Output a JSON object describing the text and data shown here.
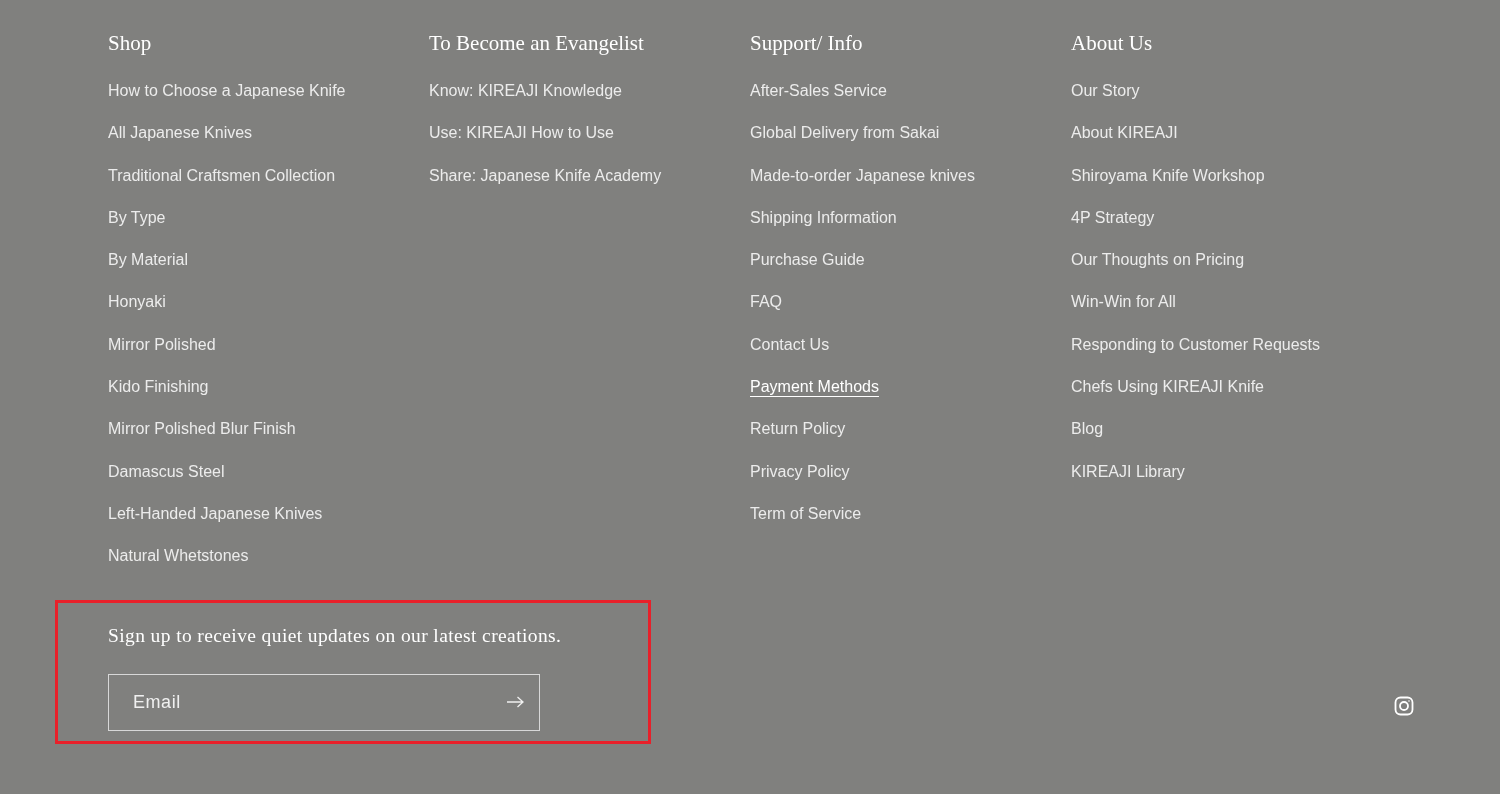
{
  "columns": [
    {
      "heading": "Shop",
      "links": [
        {
          "label": "How to Choose a Japanese Knife",
          "underlined": false
        },
        {
          "label": "All Japanese Knives",
          "underlined": false
        },
        {
          "label": "Traditional Craftsmen Collection",
          "underlined": false
        },
        {
          "label": "By Type",
          "underlined": false
        },
        {
          "label": "By Material",
          "underlined": false
        },
        {
          "label": "Honyaki",
          "underlined": false
        },
        {
          "label": "Mirror Polished",
          "underlined": false
        },
        {
          "label": "Kido Finishing",
          "underlined": false
        },
        {
          "label": "Mirror Polished Blur Finish",
          "underlined": false
        },
        {
          "label": "Damascus Steel",
          "underlined": false
        },
        {
          "label": "Left-Handed Japanese Knives",
          "underlined": false
        },
        {
          "label": "Natural Whetstones",
          "underlined": false
        }
      ]
    },
    {
      "heading": "To Become an Evangelist",
      "links": [
        {
          "label": "Know: KIREAJI Knowledge",
          "underlined": false
        },
        {
          "label": "Use: KIREAJI How to Use",
          "underlined": false
        },
        {
          "label": "Share: Japanese Knife Academy",
          "underlined": false
        }
      ]
    },
    {
      "heading": "Support/ Info",
      "links": [
        {
          "label": "After-Sales Service",
          "underlined": false
        },
        {
          "label": "Global Delivery from Sakai",
          "underlined": false
        },
        {
          "label": "Made-to-order Japanese knives",
          "underlined": false
        },
        {
          "label": "Shipping Information",
          "underlined": false
        },
        {
          "label": "Purchase Guide",
          "underlined": false
        },
        {
          "label": "FAQ",
          "underlined": false
        },
        {
          "label": "Contact Us",
          "underlined": false
        },
        {
          "label": "Payment Methods",
          "underlined": true
        },
        {
          "label": "Return Policy",
          "underlined": false
        },
        {
          "label": "Privacy Policy",
          "underlined": false
        },
        {
          "label": "Term of Service",
          "underlined": false
        }
      ]
    },
    {
      "heading": "About Us",
      "links": [
        {
          "label": "Our Story",
          "underlined": false
        },
        {
          "label": "About KIREAJI",
          "underlined": false
        },
        {
          "label": "Shiroyama Knife Workshop",
          "underlined": false
        },
        {
          "label": "4P Strategy",
          "underlined": false
        },
        {
          "label": "Our Thoughts on Pricing",
          "underlined": false
        },
        {
          "label": "Win-Win for All",
          "underlined": false
        },
        {
          "label": "Responding to Customer Requests",
          "underlined": false
        },
        {
          "label": "Chefs Using KIREAJI Knife",
          "underlined": false
        },
        {
          "label": "Blog",
          "underlined": false
        },
        {
          "label": "KIREAJI Library",
          "underlined": false
        }
      ]
    }
  ],
  "newsletter": {
    "highlighted": true,
    "text": "Sign up to receive quiet updates on our latest creations.",
    "email": {
      "placeholder": "Email"
    }
  }
}
